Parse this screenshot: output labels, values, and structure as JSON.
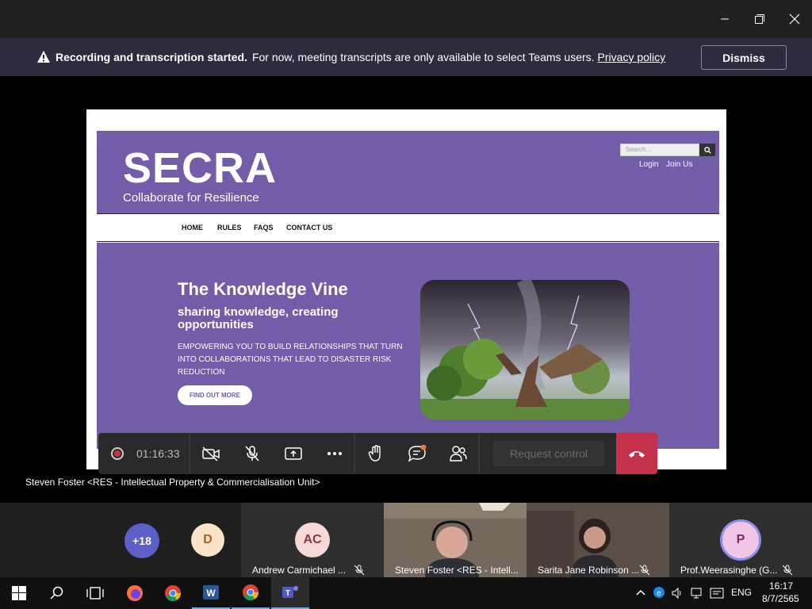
{
  "window": {
    "minimize_icon": "minimize-icon",
    "maximize_icon": "maximize-icon",
    "close_icon": "close-icon"
  },
  "banner": {
    "icon": "warning-icon",
    "bold_text": "Recording and transcription started.",
    "message": "For now, meeting transcripts are only available to select Teams users.",
    "link": "Privacy policy",
    "dismiss_label": "Dismiss"
  },
  "shared_site": {
    "logo": "SECRA",
    "tagline": "Collaborate for Resilience",
    "search_placeholder": "Search...",
    "login": "Login",
    "join": "Join Us",
    "nav": [
      "HOME",
      "RULES",
      "FAQS",
      "CONTACT US"
    ],
    "hero_title": "The Knowledge Vine",
    "hero_subtitle": "sharing knowledge, creating opportunities",
    "hero_body": "EMPOWERING YOU TO BUILD RELATIONSHIPS THAT TURN INTO COLLABORATIONS THAT LEAD TO DISASTER RISK REDUCTION",
    "hero_button": "FIND OUT MORE",
    "brand_color": "#735ca8"
  },
  "presenter": "Steven Foster <RES - Intellectual Property & Commercialisation Unit>",
  "callbar": {
    "timer": "01:16:33",
    "request_control": "Request control",
    "accent_hangup": "#c4314b"
  },
  "gallery": {
    "overflow_count": "+18",
    "avatar_d": "D",
    "tiles": [
      {
        "initials": "AC",
        "name": "Andrew Carmichael ..."
      },
      {
        "initials": "",
        "name": "Steven Foster <RES - Intell..."
      },
      {
        "initials": "",
        "name": "Sarita Jane Robinson ..."
      },
      {
        "initials": "P",
        "name": "Prof.Weerasinghe (G..."
      }
    ]
  },
  "taskbar": {
    "language": "ENG",
    "time": "16:17",
    "date": "8/7/2565"
  }
}
